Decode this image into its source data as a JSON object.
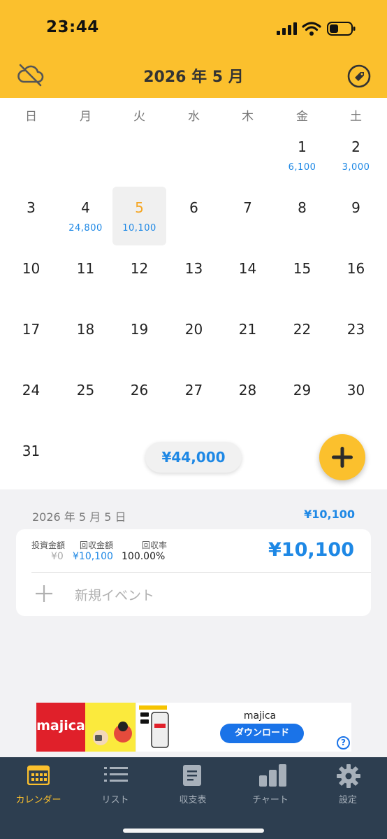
{
  "status": {
    "time": "23:44"
  },
  "header": {
    "title": "2026 年 5 月",
    "left_icon": "cloud-off-icon",
    "right_icon": "tag-icon"
  },
  "weekdays": [
    "日",
    "月",
    "火",
    "水",
    "木",
    "金",
    "土"
  ],
  "days": {
    "d1": "1",
    "d1_amount": "6,100",
    "d2": "2",
    "d2_amount": "3,000",
    "d3": "3",
    "d4": "4",
    "d4_amount": "24,800",
    "d5": "5",
    "d5_amount": "10,100",
    "d6": "6",
    "d7": "7",
    "d8": "8",
    "d9": "9",
    "d10": "10",
    "d11": "11",
    "d12": "12",
    "d13": "13",
    "d14": "14",
    "d15": "15",
    "d16": "16",
    "d17": "17",
    "d18": "18",
    "d19": "19",
    "d20": "20",
    "d21": "21",
    "d22": "22",
    "d23": "23",
    "d24": "24",
    "d25": "25",
    "d26": "26",
    "d27": "27",
    "d28": "28",
    "d29": "29",
    "d30": "30",
    "d31": "31"
  },
  "month_total": "¥44,000",
  "detail": {
    "date": "2026 年 5 月 5 日",
    "total": "¥10,100",
    "invest_label": "投資金額",
    "invest_value": "¥0",
    "return_label": "回収金額",
    "return_value": "¥10,100",
    "rate_label": "回収率",
    "rate_value": "100.00%",
    "amount": "¥10,100",
    "new_event": "新規イベント"
  },
  "ad": {
    "logo": "majica",
    "title": "majica",
    "cta": "ダウンロード",
    "help": "?"
  },
  "tabs": {
    "calendar": "カレンダー",
    "list": "リスト",
    "balance": "収支表",
    "chart": "チャート",
    "settings": "設定"
  },
  "colors": {
    "accent": "#fbc02d",
    "amount_blue": "#1e88e5",
    "tabbar": "#2d3e50"
  }
}
